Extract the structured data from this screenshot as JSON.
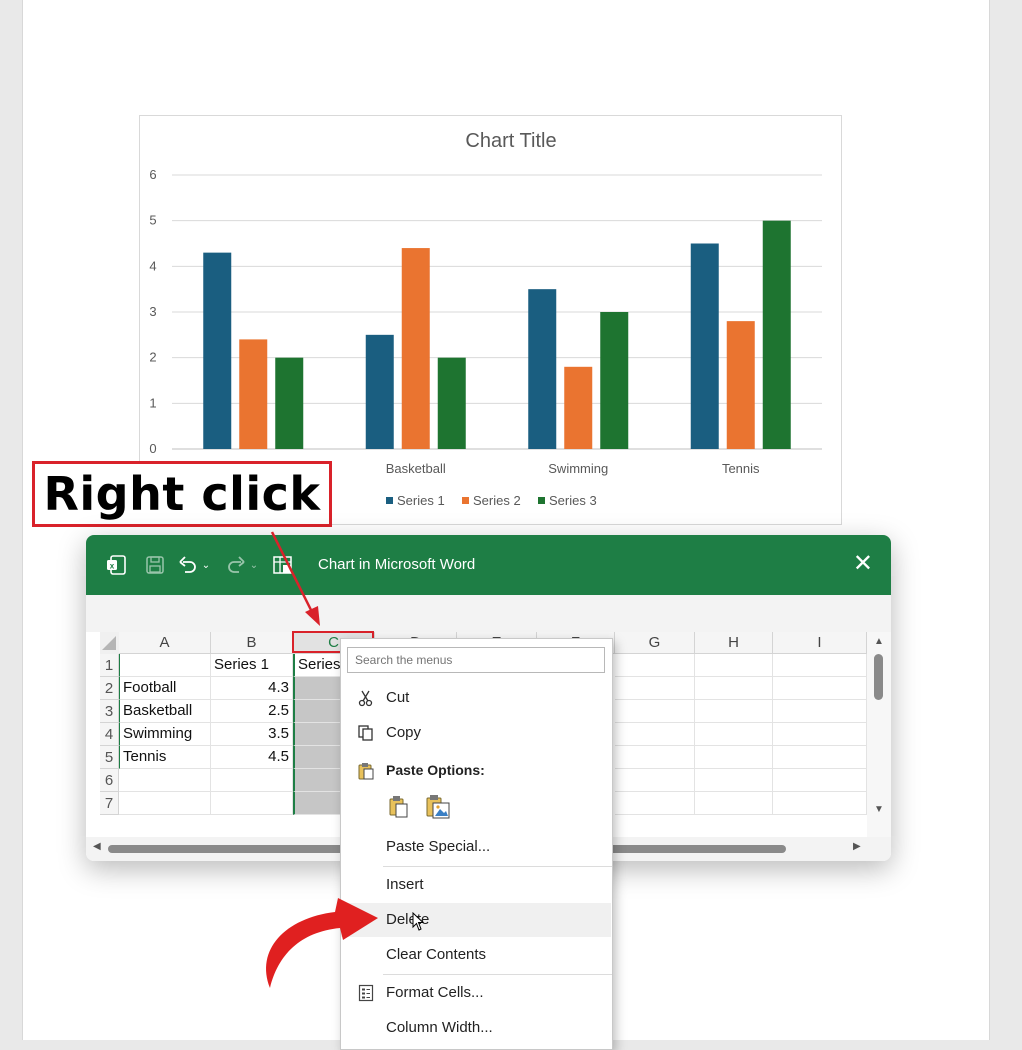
{
  "chart": {
    "title": "Chart Title"
  },
  "chart_data": {
    "type": "bar",
    "title": "Chart Title",
    "categories": [
      "Football",
      "Basketball",
      "Swimming",
      "Tennis"
    ],
    "series": [
      {
        "name": "Series 1",
        "values": [
          4.3,
          2.5,
          3.5,
          4.5
        ],
        "color": "#1a5e80"
      },
      {
        "name": "Series 2",
        "values": [
          2.4,
          4.4,
          1.8,
          2.8
        ],
        "color": "#ea7430"
      },
      {
        "name": "Series 3",
        "values": [
          2,
          2,
          3,
          5
        ],
        "color": "#1e7430"
      }
    ],
    "ylim": [
      0,
      6
    ],
    "yticks": [
      "0",
      "1",
      "2",
      "3",
      "4",
      "5",
      "6"
    ],
    "grid": true,
    "legend": "bottom"
  },
  "annotation": {
    "label": "Right click",
    "accent": "#d9222a"
  },
  "excel_window": {
    "title": "Chart in Microsoft Word",
    "close_glyph": "✕",
    "accent": "#1e7e45"
  },
  "sheet": {
    "columns": [
      "A",
      "B",
      "C",
      "D",
      "E",
      "F",
      "G",
      "H",
      "I"
    ],
    "rows": [
      "1",
      "2",
      "3",
      "4",
      "5",
      "6",
      "7"
    ],
    "cells": {
      "b1": "Series 1",
      "c1": "Series",
      "a2": "Football",
      "b2": "4.3",
      "a3": "Basketball",
      "b3": "2.5",
      "a4": "Swimming",
      "b4": "3.5",
      "a5": "Tennis",
      "b5": "4.5"
    }
  },
  "context_menu": {
    "search_placeholder": "Search the menus",
    "cut": "Cut",
    "copy": "Copy",
    "paste_options": "Paste Options:",
    "paste_special": "Paste Special...",
    "insert": "Insert",
    "delete": "Delete",
    "clear_contents": "Clear Contents",
    "format_cells": "Format Cells...",
    "column_width": "Column Width..."
  }
}
